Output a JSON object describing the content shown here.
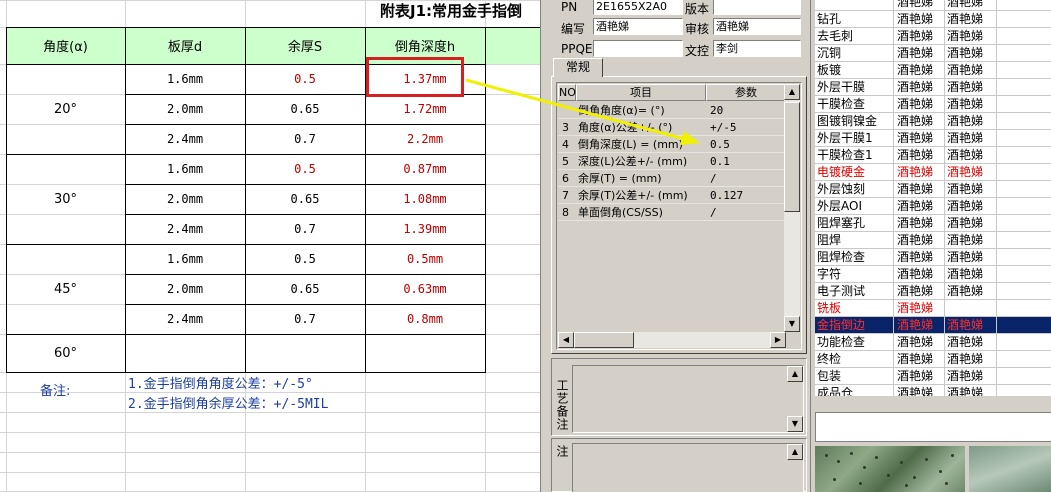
{
  "sheet": {
    "title": "附表J1:常用金手指倒",
    "headers": [
      "角度(α)",
      "板厚d",
      "余厚S",
      "倒角深度h"
    ],
    "groups": [
      {
        "angle": "20°",
        "rows": [
          {
            "thickness": "1.6mm",
            "remain": "0.5",
            "depth": "1.37mm",
            "remain_red": true
          },
          {
            "thickness": "2.0mm",
            "remain": "0.65",
            "depth": "1.72mm",
            "remain_red": false
          },
          {
            "thickness": "2.4mm",
            "remain": "0.7",
            "depth": "2.2mm",
            "remain_red": false
          }
        ]
      },
      {
        "angle": "30°",
        "rows": [
          {
            "thickness": "1.6mm",
            "remain": "0.5",
            "depth": "0.87mm",
            "remain_red": true
          },
          {
            "thickness": "2.0mm",
            "remain": "0.65",
            "depth": "1.08mm",
            "remain_red": false
          },
          {
            "thickness": "2.4mm",
            "remain": "0.7",
            "depth": "1.39mm",
            "remain_red": false
          }
        ]
      },
      {
        "angle": "45°",
        "rows": [
          {
            "thickness": "1.6mm",
            "remain": "0.5",
            "depth": "0.5mm",
            "remain_red": false
          },
          {
            "thickness": "2.0mm",
            "remain": "0.65",
            "depth": "0.63mm",
            "remain_red": false
          },
          {
            "thickness": "2.4mm",
            "remain": "0.7",
            "depth": "0.8mm",
            "remain_red": false
          }
        ]
      },
      {
        "angle": "60°",
        "rows": []
      }
    ],
    "note_label": "备注:",
    "notes": [
      "1.金手指倒角角度公差：+/-5°",
      "2.金手指倒角余厚公差：+/-5MIL"
    ],
    "colors": {
      "header_bg": "#ccffcc",
      "red_text": "#c00000",
      "note_text": "#1f3fa0",
      "highlight": "#d42020",
      "arrow": "#f0f000"
    }
  },
  "middle": {
    "pn_label": "PN",
    "pn_value": "2E1655X2A0",
    "version_label": "版本",
    "version_value": "",
    "author_label": "编写",
    "author_value": "酒艳娣",
    "reviewer_label": "审核",
    "reviewer_value": "酒艳娣",
    "ppqe_label": "PPQE",
    "ppqe_value": "",
    "controller_label": "文控",
    "controller_value": "李剑",
    "tab_label": "常规",
    "grid_headers": [
      "NO",
      "项目",
      "参数"
    ],
    "grid_rows": [
      {
        "no": "",
        "item": "倒角角度(α)=  (°)",
        "value": "20"
      },
      {
        "no": "3",
        "item": "角度(α)公差+/-  (°)",
        "value": "+/-5"
      },
      {
        "no": "4",
        "item": "倒角深度(L) =  (mm)",
        "value": "0.5"
      },
      {
        "no": "5",
        "item": "深度(L)公差+/-  (mm)",
        "value": "0.1"
      },
      {
        "no": "6",
        "item": "余厚(T) =  (mm)",
        "value": "/"
      },
      {
        "no": "7",
        "item": "余厚(T)公差+/-  (mm)",
        "value": "0.127"
      },
      {
        "no": "8",
        "item": "单面倒角(CS/SS)",
        "value": "/"
      }
    ],
    "process_remark_label": "工艺备注",
    "model_remark_label": "型号备注"
  },
  "process_list": {
    "rows": [
      {
        "step": "",
        "c2": "酒艳娣",
        "c3": "酒艳娣",
        "style": "normal"
      },
      {
        "step": "钻孔",
        "c2": "酒艳娣",
        "c3": "酒艳娣",
        "style": "normal"
      },
      {
        "step": "去毛刺",
        "c2": "酒艳娣",
        "c3": "酒艳娣",
        "style": "normal"
      },
      {
        "step": "沉铜",
        "c2": "酒艳娣",
        "c3": "酒艳娣",
        "style": "normal"
      },
      {
        "step": "板镀",
        "c2": "酒艳娣",
        "c3": "酒艳娣",
        "style": "normal"
      },
      {
        "step": "外层干膜",
        "c2": "酒艳娣",
        "c3": "酒艳娣",
        "style": "normal"
      },
      {
        "step": "干膜检查",
        "c2": "酒艳娣",
        "c3": "酒艳娣",
        "style": "normal"
      },
      {
        "step": "图镀铜镍金",
        "c2": "酒艳娣",
        "c3": "酒艳娣",
        "style": "normal"
      },
      {
        "step": "外层干膜1",
        "c2": "酒艳娣",
        "c3": "酒艳娣",
        "style": "normal"
      },
      {
        "step": "干膜检查1",
        "c2": "酒艳娣",
        "c3": "酒艳娣",
        "style": "normal"
      },
      {
        "step": "电镀硬金",
        "c2": "酒艳娣",
        "c3": "酒艳娣",
        "style": "red"
      },
      {
        "step": "外层蚀刻",
        "c2": "酒艳娣",
        "c3": "酒艳娣",
        "style": "normal"
      },
      {
        "step": "外层AOI",
        "c2": "酒艳娣",
        "c3": "酒艳娣",
        "style": "normal"
      },
      {
        "step": "阻焊塞孔",
        "c2": "酒艳娣",
        "c3": "酒艳娣",
        "style": "normal"
      },
      {
        "step": "阻焊",
        "c2": "酒艳娣",
        "c3": "酒艳娣",
        "style": "normal"
      },
      {
        "step": "阻焊检查",
        "c2": "酒艳娣",
        "c3": "酒艳娣",
        "style": "normal"
      },
      {
        "step": "字符",
        "c2": "酒艳娣",
        "c3": "酒艳娣",
        "style": "normal"
      },
      {
        "step": "电子测试",
        "c2": "酒艳娣",
        "c3": "酒艳娣",
        "style": "normal"
      },
      {
        "step": "铣板",
        "c2": "酒艳娣",
        "c3": "",
        "style": "red"
      },
      {
        "step": "金指倒边",
        "c2": "酒艳娣",
        "c3": "酒艳娣",
        "style": "selected"
      },
      {
        "step": "功能检查",
        "c2": "酒艳娣",
        "c3": "酒艳娣",
        "style": "normal"
      },
      {
        "step": "终检",
        "c2": "酒艳娣",
        "c3": "酒艳娣",
        "style": "normal"
      },
      {
        "step": "包装",
        "c2": "酒艳娣",
        "c3": "酒艳娣",
        "style": "normal"
      },
      {
        "step": "成品仓",
        "c2": "酒艳娣",
        "c3": "酒艳娣",
        "style": "normal"
      }
    ],
    "colors": {
      "selected_bg": "#0a246a",
      "red_text": "#e00000"
    }
  }
}
